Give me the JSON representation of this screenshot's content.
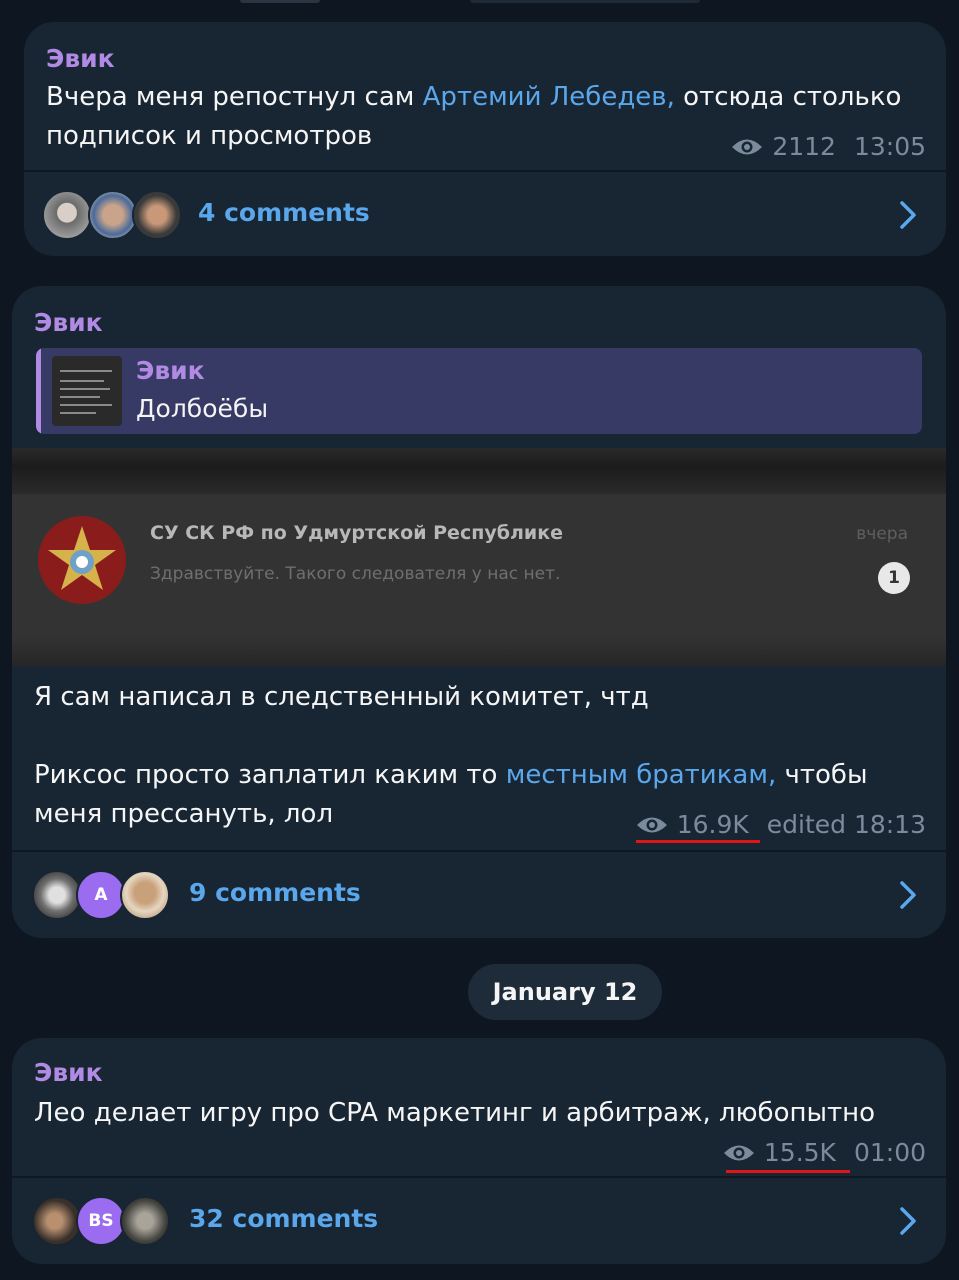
{
  "posts": [
    {
      "author": "Эвик",
      "text_before_link": "Вчера меня репостнул сам ",
      "link": "Артемий Лебедев,",
      "text_after_link": " отсюда столько подписок и просмотров",
      "views": "2112",
      "time": "13:05",
      "comments": "4 comments"
    },
    {
      "author": "Эвик",
      "quote": {
        "author": "Эвик",
        "text": "Долбоёбы"
      },
      "media": {
        "title": "СУ СК РФ по Удмуртской Республике",
        "text": "Здравствуйте. Такого следователя у нас нет.",
        "date": "вчера",
        "badge": "1"
      },
      "line1": "Я сам написал в следственный комитет, чтд",
      "line2_before_link": "Риксос просто заплатил каким то ",
      "line2_link": "местным братикам,",
      "line2_after_link": " чтобы меня прессануть, лол",
      "views": "16.9K",
      "time": "edited 18:13",
      "avatar_letter": "A",
      "comments": "9 comments"
    },
    {
      "author": "Эвик",
      "text": "Лео делает игру про CPA маркетинг и арбитраж, любопытно",
      "views": "15.5K",
      "time": "01:00",
      "avatar_letter": "BS",
      "comments": "32 comments"
    }
  ],
  "date_separator": "January 12",
  "colors": {
    "background": "#0e1621",
    "bubble": "#182533",
    "author": "#b18be3",
    "link": "#5aa7ec",
    "meta": "#7c8b9b",
    "annotation_underline": "#e01515"
  },
  "icons": [
    "eye-icon",
    "chevron-right-icon"
  ]
}
